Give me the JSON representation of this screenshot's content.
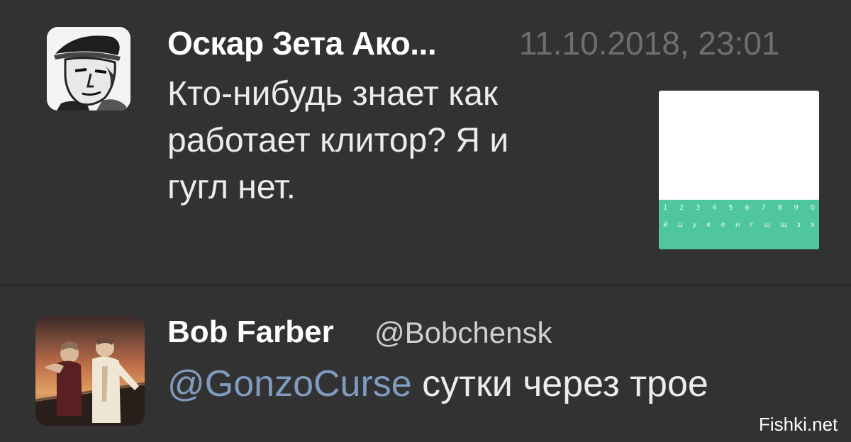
{
  "tweets": [
    {
      "author_name": "Оскар Зета Ако...",
      "timestamp": "11.10.2018, 23:01",
      "text_lines": [
        "Кто-нибудь знает как",
        "работает клитор? Я и",
        "гугл нет."
      ],
      "attachment": {
        "keyboard_row_1": [
          "1",
          "2",
          "3",
          "4",
          "5",
          "6",
          "7",
          "8",
          "9",
          "0"
        ],
        "keyboard_row_2": [
          "й",
          "ц",
          "у",
          "к",
          "е",
          "н",
          "г",
          "ш",
          "щ",
          "з",
          "х"
        ]
      }
    },
    {
      "author_name": "Bob Farber",
      "handle": "@Bobchensk",
      "mention": "@GonzoCurse",
      "text": " сутки через трое"
    }
  ],
  "watermark": "Fishki.net",
  "colors": {
    "background": "#323232",
    "divider": "#262626",
    "name": "#ffffff",
    "timestamp": "#6f6f6f",
    "mention": "#7f9bc0",
    "keyboard": "#4fc5a0"
  },
  "icons": {
    "avatar_1": "comic-pilot-portrait-avatar",
    "avatar_2": "movie-poster-couple-avatar"
  }
}
